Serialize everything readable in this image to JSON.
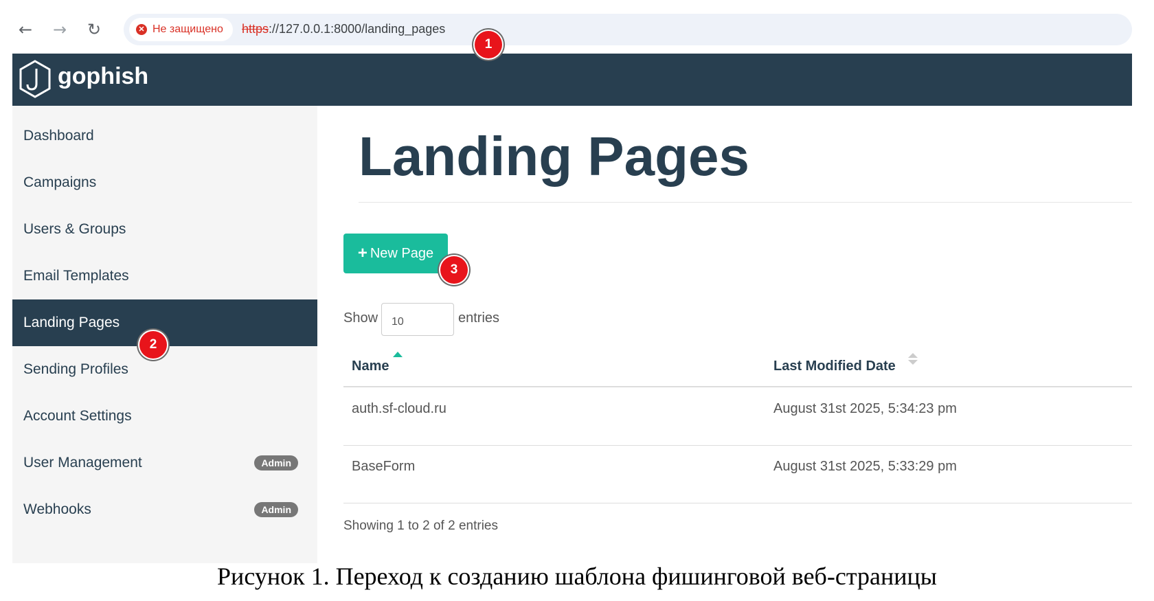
{
  "browser": {
    "security_label": "Не защищено",
    "url_scheme": "https",
    "url_rest": "://127.0.0.1:8000/landing_pages",
    "icons": {
      "back": "arrow-left-icon",
      "forward": "arrow-right-icon",
      "reload": "reload-icon",
      "warning": "warning-icon"
    }
  },
  "markers": [
    "1",
    "2",
    "3"
  ],
  "header": {
    "brand": "gophish",
    "logo_icon": "gophish-hook-logo"
  },
  "sidebar": {
    "items": [
      {
        "label": "Dashboard"
      },
      {
        "label": "Campaigns"
      },
      {
        "label": "Users & Groups"
      },
      {
        "label": "Email Templates"
      },
      {
        "label": "Landing Pages",
        "active": true
      },
      {
        "label": "Sending Profiles"
      },
      {
        "label": "Account Settings"
      },
      {
        "label": "User Management",
        "badge": "Admin"
      },
      {
        "label": "Webhooks",
        "badge": "Admin"
      }
    ]
  },
  "main": {
    "title": "Landing Pages",
    "new_page_button": "New Page",
    "show_label": "Show",
    "entries_value": "10",
    "entries_label": "entries",
    "columns": [
      "Name",
      "Last Modified Date"
    ],
    "rows": [
      {
        "name": "auth.sf-cloud.ru",
        "modified": "August 31st 2025, 5:34:23 pm"
      },
      {
        "name": "BaseForm",
        "modified": "August 31st 2025, 5:33:29 pm"
      }
    ],
    "table_info": "Showing 1 to 2 of 2 entries"
  },
  "caption": "Рисунок 1. Переход к созданию шаблона фишинговой веб-страницы",
  "colors": {
    "header": "#283f50",
    "accent": "#1abc9c",
    "marker": "#e8141b",
    "sidebar_bg": "#f5f5f5"
  }
}
